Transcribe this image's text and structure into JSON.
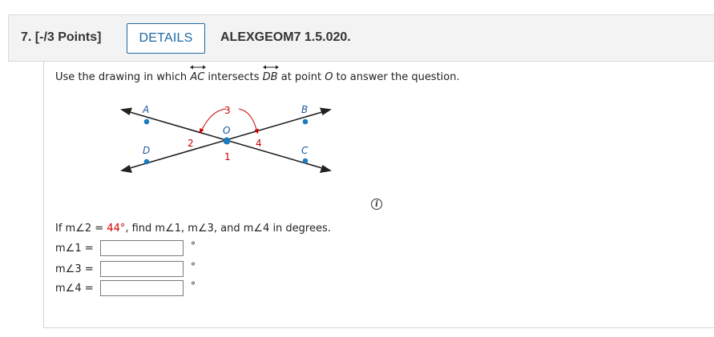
{
  "header": {
    "question_number": "7.  [-/3 Points]",
    "details_label": "DETAILS",
    "problem_id": "ALEXGEOM7 1.5.020."
  },
  "prompt": {
    "before": "Use the drawing in which ",
    "line1": "AC",
    "middle": " intersects ",
    "line2": "DB",
    "before_point": " at point ",
    "point": "O",
    "after": " to answer the question."
  },
  "diagram": {
    "labels": {
      "A": "A",
      "B": "B",
      "C": "C",
      "D": "D",
      "O": "O"
    },
    "angles": {
      "a1": "1",
      "a2": "2",
      "a3": "3",
      "a4": "4"
    },
    "colors": {
      "point": "#1b7bbf",
      "arc": "#cc0000",
      "line": "#222222"
    }
  },
  "question": {
    "before": "If m∠2 = ",
    "value": "44°",
    "after": ", find m∠1, m∠3, and m∠4 in degrees."
  },
  "answers": [
    {
      "label": "m∠1  =",
      "value": "",
      "unit": "°"
    },
    {
      "label": "m∠3  =",
      "value": "",
      "unit": "°"
    },
    {
      "label": "m∠4  =",
      "value": "",
      "unit": "°"
    }
  ],
  "info_icon": "info-icon"
}
